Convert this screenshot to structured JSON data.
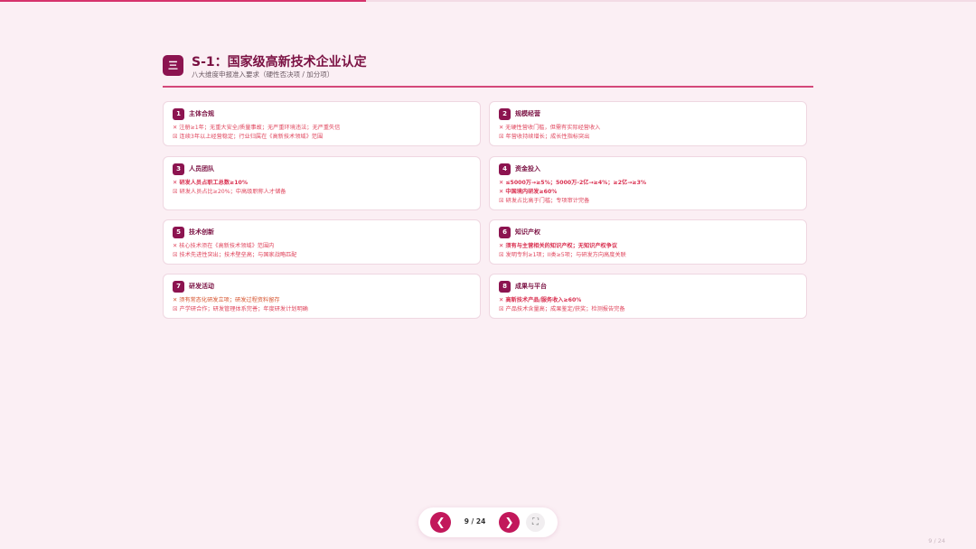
{
  "progress": {
    "fraction": 0.375,
    "color": "#d6336c"
  },
  "header": {
    "badge_icon": "三",
    "title": "S-1：国家级高新技术企业认定",
    "subtitle": "八大维度申报准入要求（硬性否决项 / 加分项）"
  },
  "cards": [
    {
      "num": "1",
      "title": "主体合规",
      "line1": "✕ 注册≥1年；无重大安全/质量事故；无严重环境违法；无严重失信",
      "line2": "☒ 连续3年以上经营稳定；行业归属在《高新技术领域》范围"
    },
    {
      "num": "2",
      "title": "规模经营",
      "line1": "✕ 无硬性营收门槛，但需有实际经营收入",
      "line2": "☒ 年营收持续增长；成长性指标突出"
    },
    {
      "num": "3",
      "title": "人员团队",
      "line1": "✕ 研发人员占职工总数≥10%",
      "line2": "☒ 研发人员占比≥20%；中高级职称人才储备"
    },
    {
      "num": "4",
      "title": "资金投入",
      "line1": "✕ ≤5000万→≥5%；5000万-2亿→≥4%；≥2亿→≥3%",
      "line2": "✕ 中国境内研发≥60%",
      "line3": "☒ 研发占比高于门槛；专项审计完备"
    },
    {
      "num": "5",
      "title": "技术创新",
      "line1": "✕ 核心技术须在《高新技术领域》范围内",
      "line2": "☒ 技术先进性突出；技术壁垒高；与国家战略匹配"
    },
    {
      "num": "6",
      "title": "知识产权",
      "line1": "✕ 须有与主营相关的知识产权；无知识产权争议",
      "line2": "☒ 发明专利≥1项；II类≥5项；与研发方向高度关联"
    },
    {
      "num": "7",
      "title": "研发活动",
      "line1": "✕ 须有常态化研发立项；研发过程资料留存",
      "line2": "☒ 产学研合作；研发管理体系完善；年度研发计划明确"
    },
    {
      "num": "8",
      "title": "成果与平台",
      "line1": "✕ 高新技术产品/服务收入≥60%",
      "line2": "☒ 产品技术含量高；成果鉴定/获奖；检测报告完备"
    }
  ],
  "nav": {
    "prev_icon": "❮",
    "next_icon": "❯",
    "page_label": "9 / 24",
    "fullscreen_icon": "⛶"
  },
  "corner_counter": "9 / 24"
}
